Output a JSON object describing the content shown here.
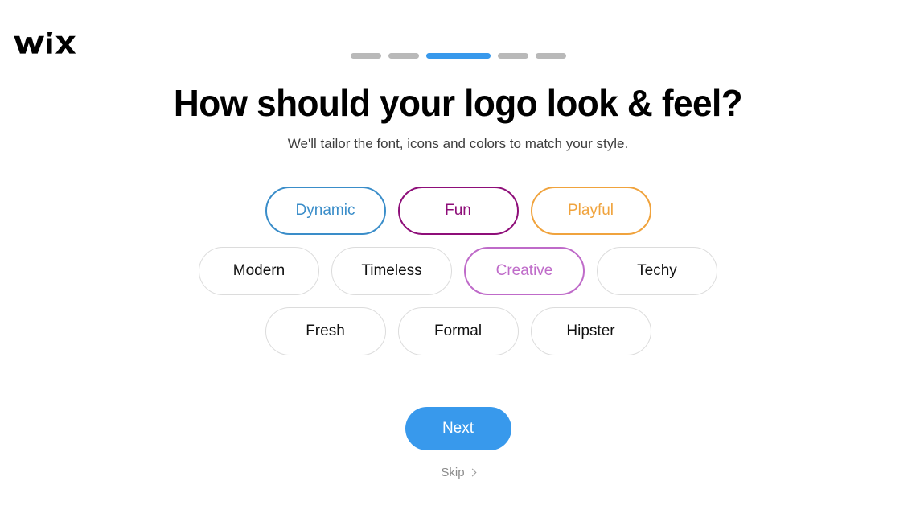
{
  "brand": {
    "logo_text": "WiX",
    "logo_icon": "wix-logo"
  },
  "progress": {
    "total_steps": 5,
    "current_step": 3,
    "active_color": "#3899ec",
    "inactive_color": "#b9b9b9",
    "steps": [
      {
        "label": "step-1",
        "active": false
      },
      {
        "label": "step-2",
        "active": false
      },
      {
        "label": "step-3",
        "active": true
      },
      {
        "label": "step-4",
        "active": false
      },
      {
        "label": "step-5",
        "active": false
      }
    ]
  },
  "main": {
    "title": "How should your logo look & feel?",
    "subtitle": "We'll tailor the font, icons and colors to match your style."
  },
  "options": {
    "rows": [
      [
        {
          "label": "Dynamic",
          "selected": true,
          "color": "#3a8dc9"
        },
        {
          "label": "Fun",
          "selected": true,
          "color": "#8e0e79"
        },
        {
          "label": "Playful",
          "selected": true,
          "color": "#f0a33d"
        }
      ],
      [
        {
          "label": "Modern",
          "selected": false,
          "color": "#111111"
        },
        {
          "label": "Timeless",
          "selected": false,
          "color": "#111111"
        },
        {
          "label": "Creative",
          "selected": true,
          "color": "#bf6bc9"
        },
        {
          "label": "Techy",
          "selected": false,
          "color": "#111111"
        }
      ],
      [
        {
          "label": "Fresh",
          "selected": false,
          "color": "#111111"
        },
        {
          "label": "Formal",
          "selected": false,
          "color": "#111111"
        },
        {
          "label": "Hipster",
          "selected": false,
          "color": "#111111"
        }
      ]
    ],
    "default_border_color": "#dcdcdc"
  },
  "actions": {
    "next_label": "Next",
    "next_color": "#3899ec",
    "skip_label": "Skip",
    "skip_icon": "chevron-right-icon"
  }
}
